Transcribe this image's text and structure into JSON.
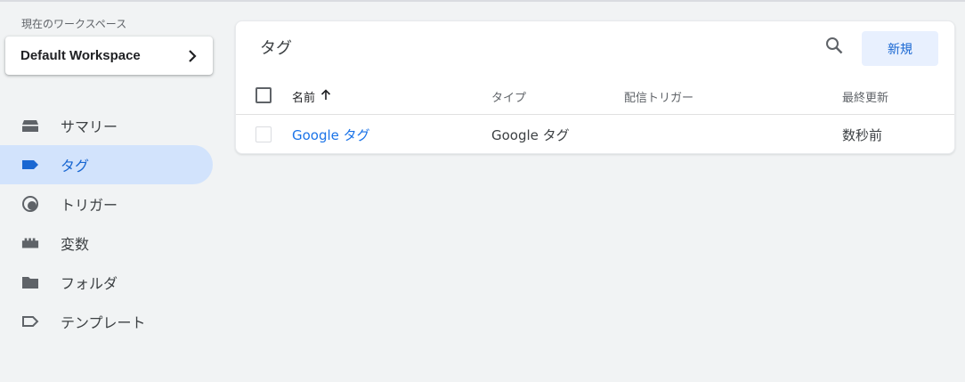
{
  "sidebar": {
    "workspace_label": "現在のワークスペース",
    "workspace_name": "Default Workspace",
    "items": [
      {
        "label": "サマリー",
        "icon": "summary-icon"
      },
      {
        "label": "タグ",
        "icon": "tag-icon",
        "active": true
      },
      {
        "label": "トリガー",
        "icon": "trigger-icon"
      },
      {
        "label": "変数",
        "icon": "variable-icon"
      },
      {
        "label": "フォルダ",
        "icon": "folder-icon"
      },
      {
        "label": "テンプレート",
        "icon": "template-icon"
      }
    ]
  },
  "main": {
    "title": "タグ",
    "new_button": "新規",
    "columns": {
      "name": "名前",
      "type": "タイプ",
      "trigger": "配信トリガー",
      "updated": "最終更新"
    },
    "rows": [
      {
        "name": "Google タグ",
        "type": "Google タグ",
        "trigger": "",
        "updated": "数秒前"
      }
    ]
  },
  "colors": {
    "accent": "#1967d2",
    "link": "#1a73e8",
    "active_bg": "#d2e3fc",
    "button_bg": "#e8f0fe",
    "page_bg": "#f1f3f4"
  }
}
